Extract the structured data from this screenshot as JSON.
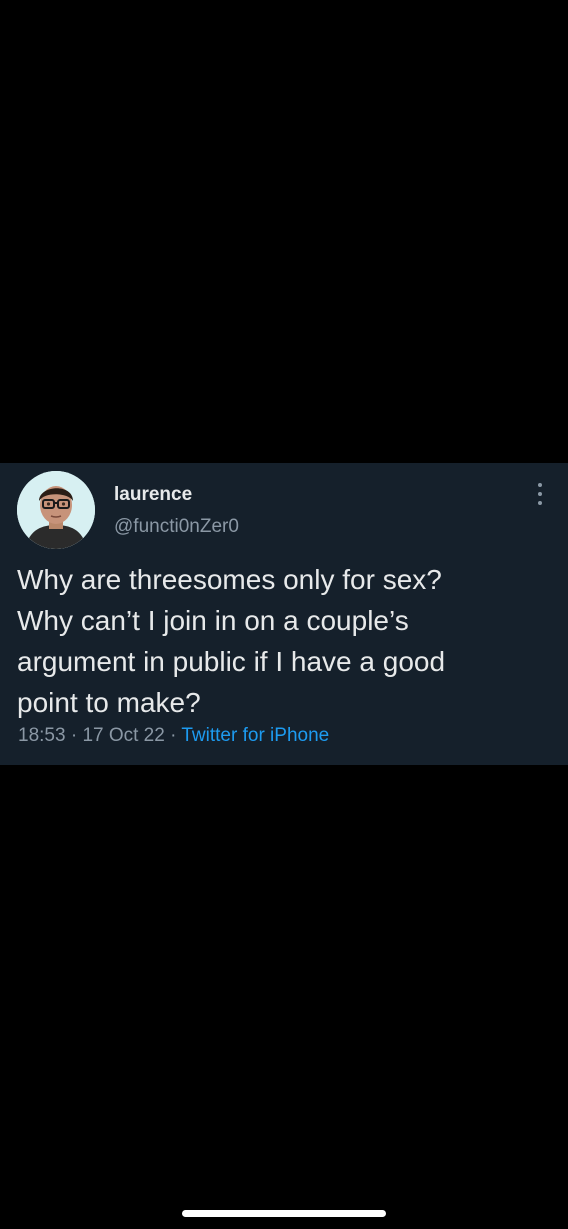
{
  "tweet": {
    "author": {
      "display_name": "laurence",
      "handle": "@functi0nZer0",
      "avatar_icon": "user-avatar"
    },
    "text_lines": [
      "Why are threesomes only for sex?",
      "Why can’t I join in on a couple’s",
      "argument in public if I have a good",
      "point to make?"
    ],
    "meta": {
      "time": "18:53",
      "separator": " · ",
      "date": "17 Oct 22",
      "source": "Twitter for iPhone"
    },
    "more_icon": "more-vertical-icon"
  },
  "colors": {
    "background": "#000000",
    "card": "#15202b",
    "primary_text": "#e7e9ea",
    "secondary_text": "#8b98a5",
    "link": "#1d9bf0"
  }
}
